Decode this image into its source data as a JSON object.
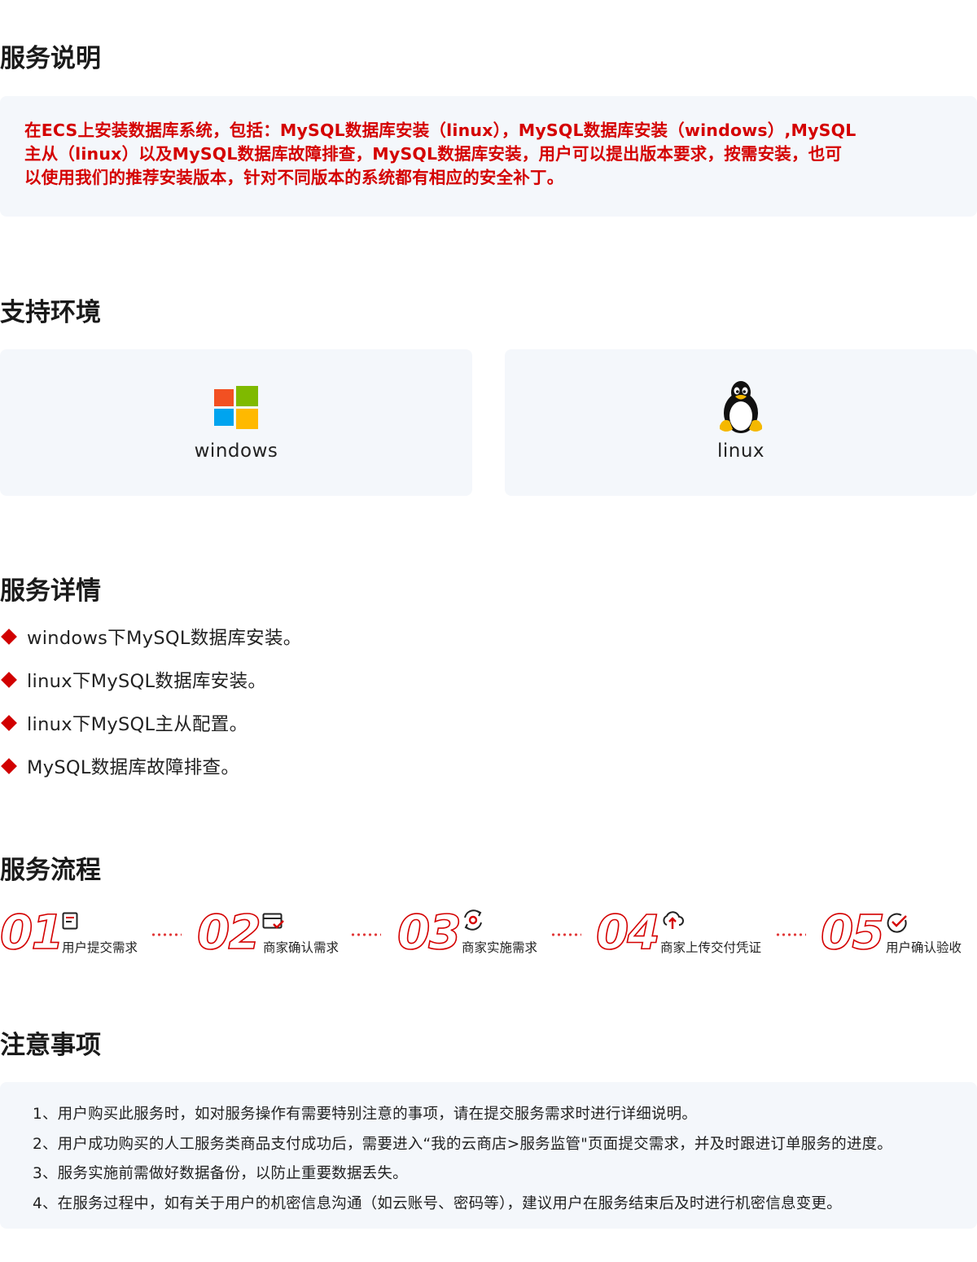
{
  "sections": {
    "description_title": "服务说明",
    "environment_title": "支持环境",
    "details_title": "服务详情",
    "process_title": "服务流程",
    "notes_title": "注意事项"
  },
  "description": {
    "lines": [
      "在ECS上安装数据库系统，包括：MySQL数据库安装（linux），MySQL数据库安装（windows）,MySQL",
      "主从（linux）以及MySQL数据库故障排查，MySQL数据库安装，用户可以提出版本要求，按需安装，也可",
      "以使用我们的推荐安装版本，针对不同版本的系统都有相应的安全补丁。"
    ],
    "color": "#d40000"
  },
  "environments": [
    {
      "label": "windows",
      "icon": "windows-logo-icon"
    },
    {
      "label": "linux",
      "icon": "linux-penguin-icon"
    }
  ],
  "details": [
    "windows下MySQL数据库安装。",
    "linux下MySQL数据库安装。",
    "linux下MySQL主从配置。",
    "MySQL数据库故障排查。"
  ],
  "process": [
    {
      "num": "01",
      "label": "用户提交需求",
      "icon": "document-icon"
    },
    {
      "num": "02",
      "label": "商家确认需求",
      "icon": "checklist-icon"
    },
    {
      "num": "03",
      "label": "商家实施需求",
      "icon": "gear-cycle-icon"
    },
    {
      "num": "04",
      "label": "商家上传交付凭证",
      "icon": "cloud-upload-icon"
    },
    {
      "num": "05",
      "label": "用户确认验收",
      "icon": "check-circle-icon"
    }
  ],
  "notes": [
    "1、用户购买此服务时，如对服务操作有需要特别注意的事项，请在提交服务需求时进行详细说明。",
    "2、用户成功购买的人工服务类商品支付成功后，需要进入“我的云商店>服务监管\"页面提交需求，并及时跟进订单服务的进度。",
    "3、服务实施前需做好数据备份，以防止重要数据丢失。",
    "4、在服务过程中，如有关于用户的机密信息沟通（如云账号、密码等），建议用户在服务结束后及时进行机密信息变更。"
  ],
  "colors": {
    "accent": "#d40000",
    "panel_bg": "#f4f7fb"
  }
}
